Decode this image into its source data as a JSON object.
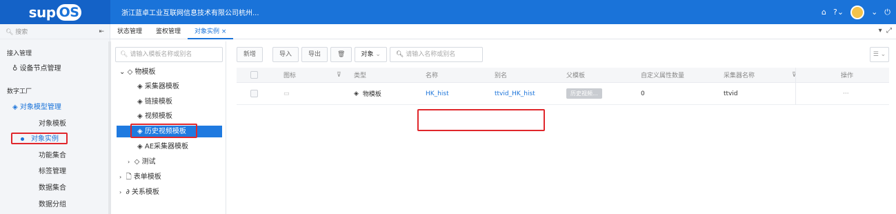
{
  "header": {
    "logo_text": "sup",
    "logo_os": "OS",
    "company": "浙江蓝卓工业互联网信息技术有限公司杭州...",
    "icons": [
      "home-icon",
      "help-icon",
      "avatar",
      "power-icon"
    ]
  },
  "sidebar": {
    "search_placeholder": "搜索",
    "collapse_icon": "collapse-icon",
    "groups": [
      {
        "title": "接入管理",
        "items": [
          {
            "label": "设备节点管理",
            "icon": "node-icon"
          }
        ]
      },
      {
        "title": "数字工厂",
        "items": [
          {
            "label": "对象模型管理",
            "icon": "cube-icon",
            "active_group": true
          }
        ]
      }
    ],
    "sub_items": [
      "对象模板",
      "对象实例",
      "功能集合",
      "标签管理",
      "数据集合",
      "数据分组"
    ],
    "active_sub": "对象实例"
  },
  "tabs": [
    {
      "label": "状态管理"
    },
    {
      "label": "鉴权管理"
    },
    {
      "label": "对象实例",
      "active": true
    }
  ],
  "tree": {
    "search_placeholder": "请输入模板名称或别名",
    "nodes": [
      {
        "label": "物模板",
        "level": 0,
        "expanded": true
      },
      {
        "label": "采集器模板",
        "level": 1
      },
      {
        "label": "链接模板",
        "level": 1
      },
      {
        "label": "视频模板",
        "level": 1
      },
      {
        "label": "历史视频模板",
        "level": 1,
        "selected": true
      },
      {
        "label": "AE采集器模板",
        "level": 1
      },
      {
        "label": "测试",
        "level": 1,
        "collapsed": true
      },
      {
        "label": "表单模板",
        "level": 0,
        "collapsed": true
      },
      {
        "label": "关系模板",
        "level": 0,
        "collapsed": true
      }
    ]
  },
  "toolbar": {
    "new_label": "新增",
    "import_label": "导入",
    "export_label": "导出",
    "type_select": "对象",
    "search_placeholder": "请输入名称或别名",
    "menu_label": "☰ ⌄"
  },
  "table": {
    "columns": [
      "图标",
      "类型",
      "名称",
      "别名",
      "父模板",
      "自定义属性数量",
      "采集器名称",
      "操作"
    ],
    "rows": [
      {
        "type": "物模板",
        "name": "HK_hist",
        "alias": "ttvid_HK_hist",
        "parent": "历史视频...",
        "custom_count": "0",
        "collector": "ttvid",
        "actions": "···"
      }
    ]
  },
  "colors": {
    "brand": "#1a73d9",
    "highlight": "#e0262b"
  }
}
